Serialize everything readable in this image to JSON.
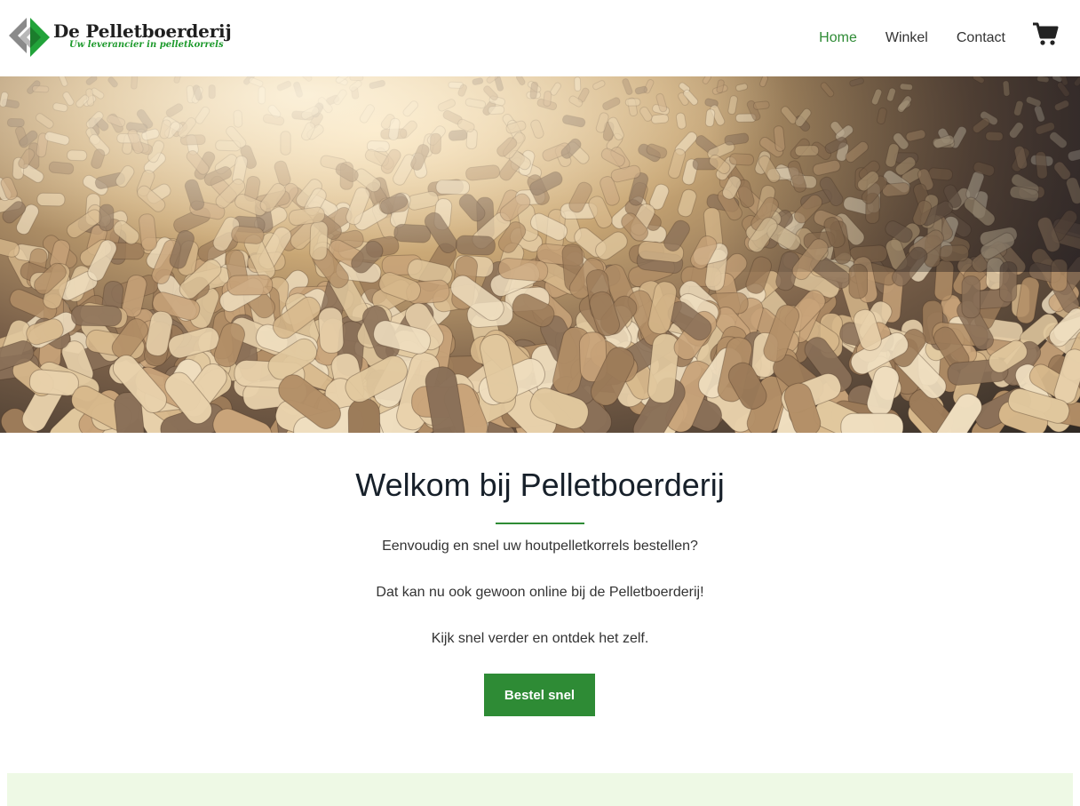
{
  "header": {
    "logo": {
      "title": "De Pelletboerderij",
      "subtitle": "Uw leverancier in pelletkorrels"
    },
    "nav": [
      {
        "label": "Home",
        "active": true
      },
      {
        "label": "Winkel",
        "active": false
      },
      {
        "label": "Contact",
        "active": false
      }
    ],
    "cart_icon": "shopping-cart-icon"
  },
  "hero": {
    "image": "wood-pellets-pile"
  },
  "main": {
    "title": "Welkom bij Pelletboerderij",
    "paragraphs": [
      "Eenvoudig en snel uw houtpelletkorrels bestellen?",
      "Dat kan nu ook gewoon online bij de Pelletboerderij!",
      "Kijk snel verder en ontdek het zelf."
    ],
    "cta_label": "Bestel snel"
  },
  "colors": {
    "accent": "#2e8b35",
    "footer_band": "#eef9e5",
    "title_text": "#17202a"
  }
}
